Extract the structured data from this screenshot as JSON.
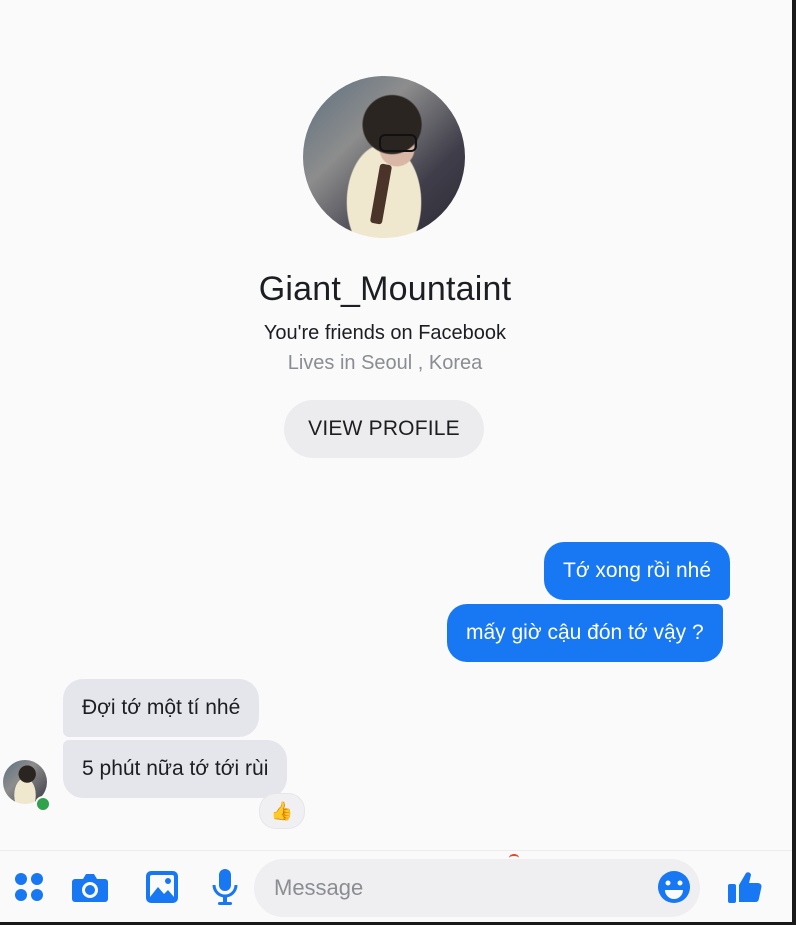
{
  "profile": {
    "name": "Giant_Mountaint",
    "relationship": "You're friends on Facebook",
    "location": "Lives in Seoul , Korea",
    "view_profile_label": "VIEW PROFILE"
  },
  "messages": [
    {
      "direction": "outgoing",
      "text": "Tớ xong rồi nhé"
    },
    {
      "direction": "outgoing",
      "text": "mấy giờ cậu đón tớ vậy ?"
    },
    {
      "direction": "incoming",
      "text": "Đợi tớ một tí nhé"
    },
    {
      "direction": "incoming",
      "text": "5 phút nữa tớ tới rùi"
    }
  ],
  "reaction": {
    "emoji": "👍"
  },
  "composer": {
    "placeholder": "Message",
    "icons": [
      "apps-icon",
      "camera-icon",
      "image-icon",
      "microphone-icon",
      "emoji-icon",
      "thumbs-up-icon"
    ]
  },
  "colors": {
    "accent": "#1877f2",
    "incoming_bubble": "#e4e6eb",
    "online": "#31a24c"
  }
}
